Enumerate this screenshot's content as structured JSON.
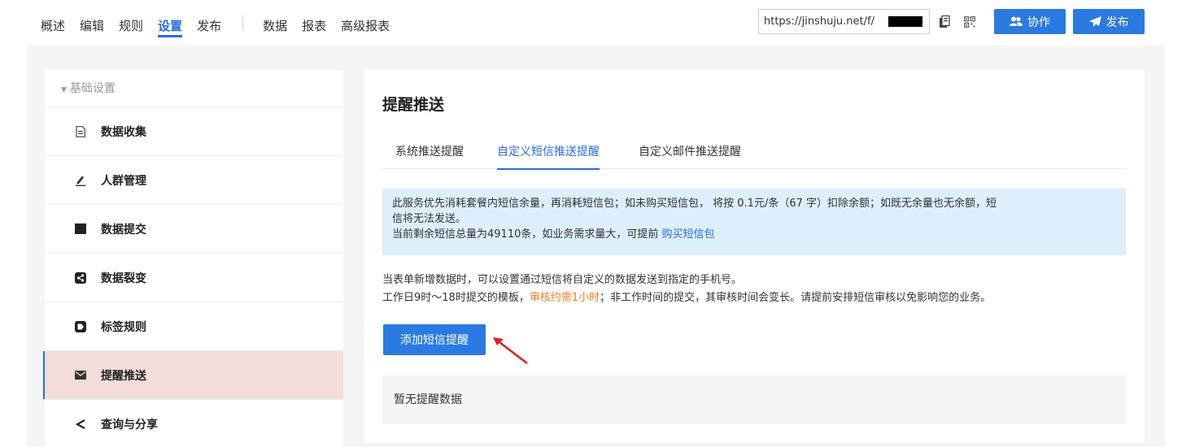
{
  "nav": {
    "items": [
      "概述",
      "编辑",
      "规则",
      "设置",
      "发布"
    ],
    "items2": [
      "数据",
      "报表",
      "高级报表"
    ],
    "active": "设置"
  },
  "topbar": {
    "url": "https://jinshuju.net/f/",
    "collab_label": "协作",
    "publish_label": "发布"
  },
  "sidebar": {
    "section_label": "基础设置",
    "items": [
      {
        "label": "数据收集",
        "icon": "document-icon"
      },
      {
        "label": "人群管理",
        "icon": "pen-icon"
      },
      {
        "label": "数据提交",
        "icon": "square-icon"
      },
      {
        "label": "数据裂变",
        "icon": "split-icon"
      },
      {
        "label": "标签规则",
        "icon": "tag-icon"
      },
      {
        "label": "提醒推送",
        "icon": "envelope-icon"
      },
      {
        "label": "查询与分享",
        "icon": "share-icon"
      }
    ],
    "active_index": 5
  },
  "main": {
    "title": "提醒推送",
    "tabs": [
      "系统推送提醒",
      "自定义短信推送提醒",
      "自定义邮件推送提醒"
    ],
    "active_tab": 1,
    "notice": {
      "line1": "此服务优先消耗套餐内短信余量，再消耗短信包；如未购买短信包， 将按 0.1元/条（67 字）扣除余额；如既无余量也无余额，短",
      "line2": "信将无法发送。",
      "line3": "当前剩余短信总量为49110条，如业务需求量大，可提前 ",
      "link": "购买短信包"
    },
    "desc": {
      "line1": "当表单新增数据时，可以设置通过短信将自定义的数据发送到指定的手机号。",
      "line2_a": "工作日9时～18时提交的模板，",
      "line2_highlight": "审核约需1小时",
      "line2_b": "；非工作时间的提交，其审核时间会变长。请提前安排短信审核以免影响您的业务。"
    },
    "add_button": "添加短信提醒",
    "empty_text": "暂无提醒数据"
  },
  "colors": {
    "accent": "#2a6be0",
    "button": "#2a7ae2",
    "notice_bg": "#ddeefc",
    "highlight": "#f07d1f",
    "active_side": "#f2ddd8",
    "arrow": "#e02020"
  }
}
